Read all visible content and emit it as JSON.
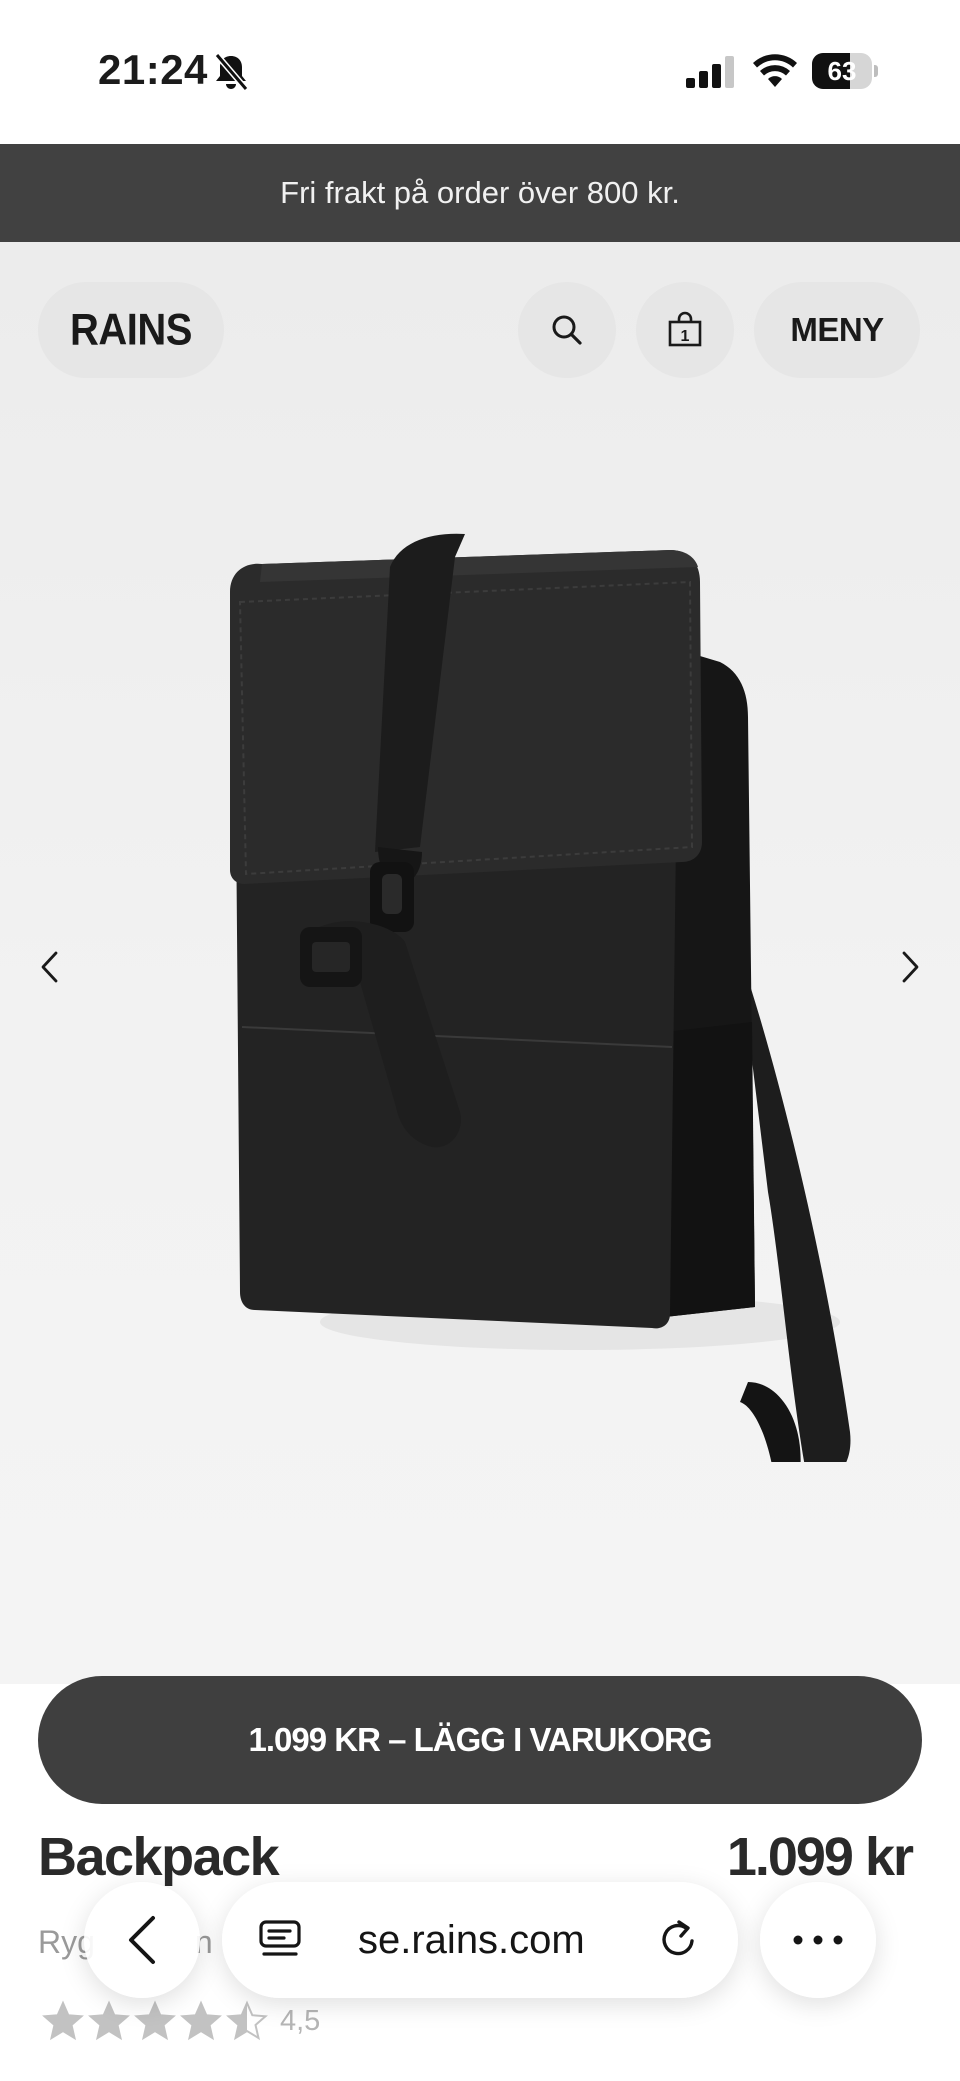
{
  "status_bar": {
    "time": "21:24",
    "battery_level": "63",
    "battery_fraction": 0.63,
    "icons": [
      "bell-slash-icon",
      "cellular-signal-icon",
      "wifi-icon",
      "battery-icon"
    ]
  },
  "promo": {
    "text": "Fri frakt på order över 800 kr."
  },
  "header": {
    "logo": "RAINS",
    "menu_label": "MENY",
    "icons": [
      "search-icon",
      "shopping-bag-icon"
    ],
    "cart_count": "1"
  },
  "gallery": {
    "icons": [
      "chevron-left-icon",
      "chevron-right-icon"
    ],
    "image": "black-backpack-photo"
  },
  "cta": {
    "label": "1.099 KR – LÄGG I VARUKORG"
  },
  "product": {
    "name": "Backpack",
    "price": "1.099 kr",
    "subtitle_visible_start": "Ryg",
    "subtitle_visible_mid": "n",
    "rating_value": "4,5",
    "rating": 4.5,
    "rating_max": 5
  },
  "browser": {
    "url": "se.rains.com",
    "icons": [
      "back-chevron-icon",
      "tabs-icon",
      "reload-icon",
      "more-icon"
    ]
  },
  "colors": {
    "promo_bg": "#414141",
    "cta_bg": "#3f3f3f",
    "hero_bg": "#ececec",
    "text_dark": "#1b1b1b"
  }
}
